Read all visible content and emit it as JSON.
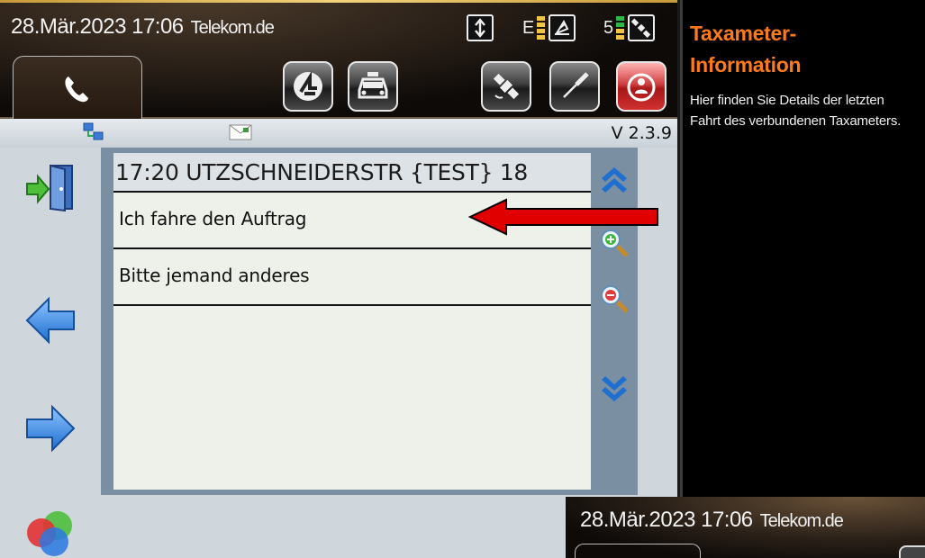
{
  "status_bar": {
    "datetime": "28.Mär.2023 17:06",
    "carrier": "Telekom.de",
    "signal_label": "E",
    "satellite_count": "5"
  },
  "toolbar": {
    "buttons": [
      {
        "name": "dispatch-button",
        "icon": "dispatch-logo-icon"
      },
      {
        "name": "taxi-button",
        "icon": "taxi-icon"
      },
      {
        "name": "gps-button",
        "icon": "satellite-icon"
      },
      {
        "name": "tools-button",
        "icon": "screwdriver-icon"
      },
      {
        "name": "alarm-button",
        "icon": "alarm-person-icon"
      }
    ]
  },
  "panel": {
    "version": "V 2.3.9",
    "order_header": "17:20 UTZSCHNEIDERSTR  {TEST} 18",
    "options": [
      {
        "label": "Ich fahre den Auftrag"
      },
      {
        "label": "Bitte jemand anderes"
      }
    ]
  },
  "info_panel": {
    "title_line1": "Taxameter-",
    "title_line2": "Information",
    "description": "Hier finden Sie Details der letzten Fahrt des verbundenen Taxameters."
  },
  "thumbnail": {
    "datetime": "28.Mär.2023 17:06",
    "carrier": "Telekom.de"
  },
  "colors": {
    "accent_orange": "#ff7a1a",
    "arrow_red": "#e00000",
    "list_frame": "#7b8fa3",
    "panel_bg": "#cfd6dc"
  }
}
